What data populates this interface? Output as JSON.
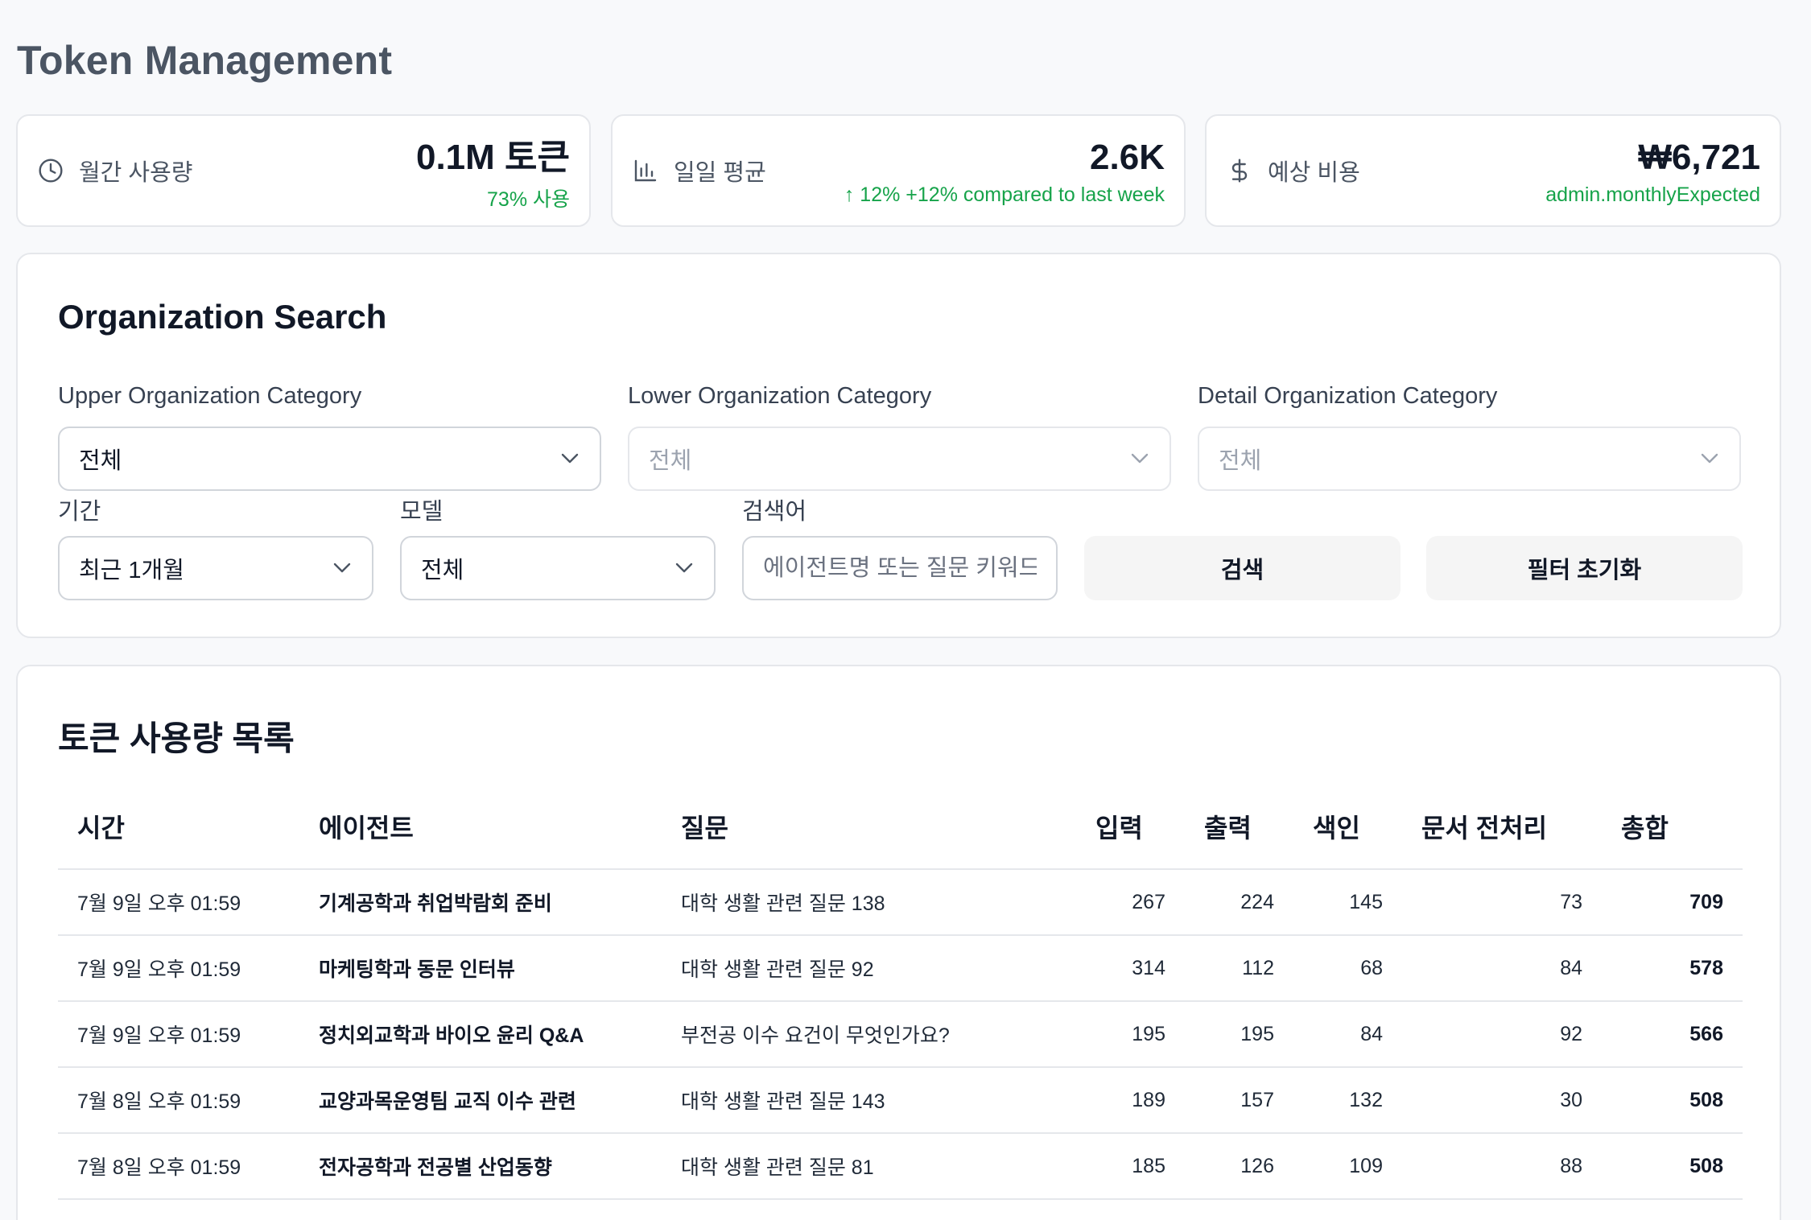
{
  "page": {
    "title": "Token Management"
  },
  "stats": [
    {
      "label": "월간 사용량",
      "icon": "clock-icon",
      "value": "0.1M 토큰",
      "sub": "73% 사용"
    },
    {
      "label": "일일 평균",
      "icon": "bar-chart-icon",
      "value": "2.6K",
      "sub": "↑ 12% +12% compared to last week"
    },
    {
      "label": "예상 비용",
      "icon": "dollar-icon",
      "value": "₩6,721",
      "sub": "admin.monthlyExpected"
    }
  ],
  "search": {
    "title": "Organization Search",
    "upper": {
      "label": "Upper Organization Category",
      "value": "전체"
    },
    "lower": {
      "label": "Lower Organization Category",
      "value": "전체"
    },
    "detail": {
      "label": "Detail Organization Category",
      "value": "전체"
    },
    "period": {
      "label": "기간",
      "value": "최근 1개월"
    },
    "model": {
      "label": "모델",
      "value": "전체"
    },
    "keyword": {
      "label": "검색어",
      "placeholder": "에이전트명 또는 질문 키워드"
    },
    "search_button": "검색",
    "reset_button": "필터 초기화"
  },
  "usage": {
    "title": "토큰 사용량 목록",
    "columns": [
      "시간",
      "에이전트",
      "질문",
      "입력",
      "출력",
      "색인",
      "문서 전처리",
      "총합"
    ],
    "rows": [
      [
        "7월 9일 오후 01:59",
        "기계공학과 취업박람회 준비",
        "대학 생활 관련 질문 138",
        "267",
        "224",
        "145",
        "73",
        "709"
      ],
      [
        "7월 9일 오후 01:59",
        "마케팅학과 동문 인터뷰",
        "대학 생활 관련 질문 92",
        "314",
        "112",
        "68",
        "84",
        "578"
      ],
      [
        "7월 9일 오후 01:59",
        "정치외교학과 바이오 윤리 Q&A",
        "부전공 이수 요건이 무엇인가요?",
        "195",
        "195",
        "84",
        "92",
        "566"
      ],
      [
        "7월 8일 오후 01:59",
        "교양과목운영팀 교직 이수 관련",
        "대학 생활 관련 질문 143",
        "189",
        "157",
        "132",
        "30",
        "508"
      ],
      [
        "7월 8일 오후 01:59",
        "전자공학과 전공별 산업동향",
        "대학 생활 관련 질문 81",
        "185",
        "126",
        "109",
        "88",
        "508"
      ]
    ]
  }
}
